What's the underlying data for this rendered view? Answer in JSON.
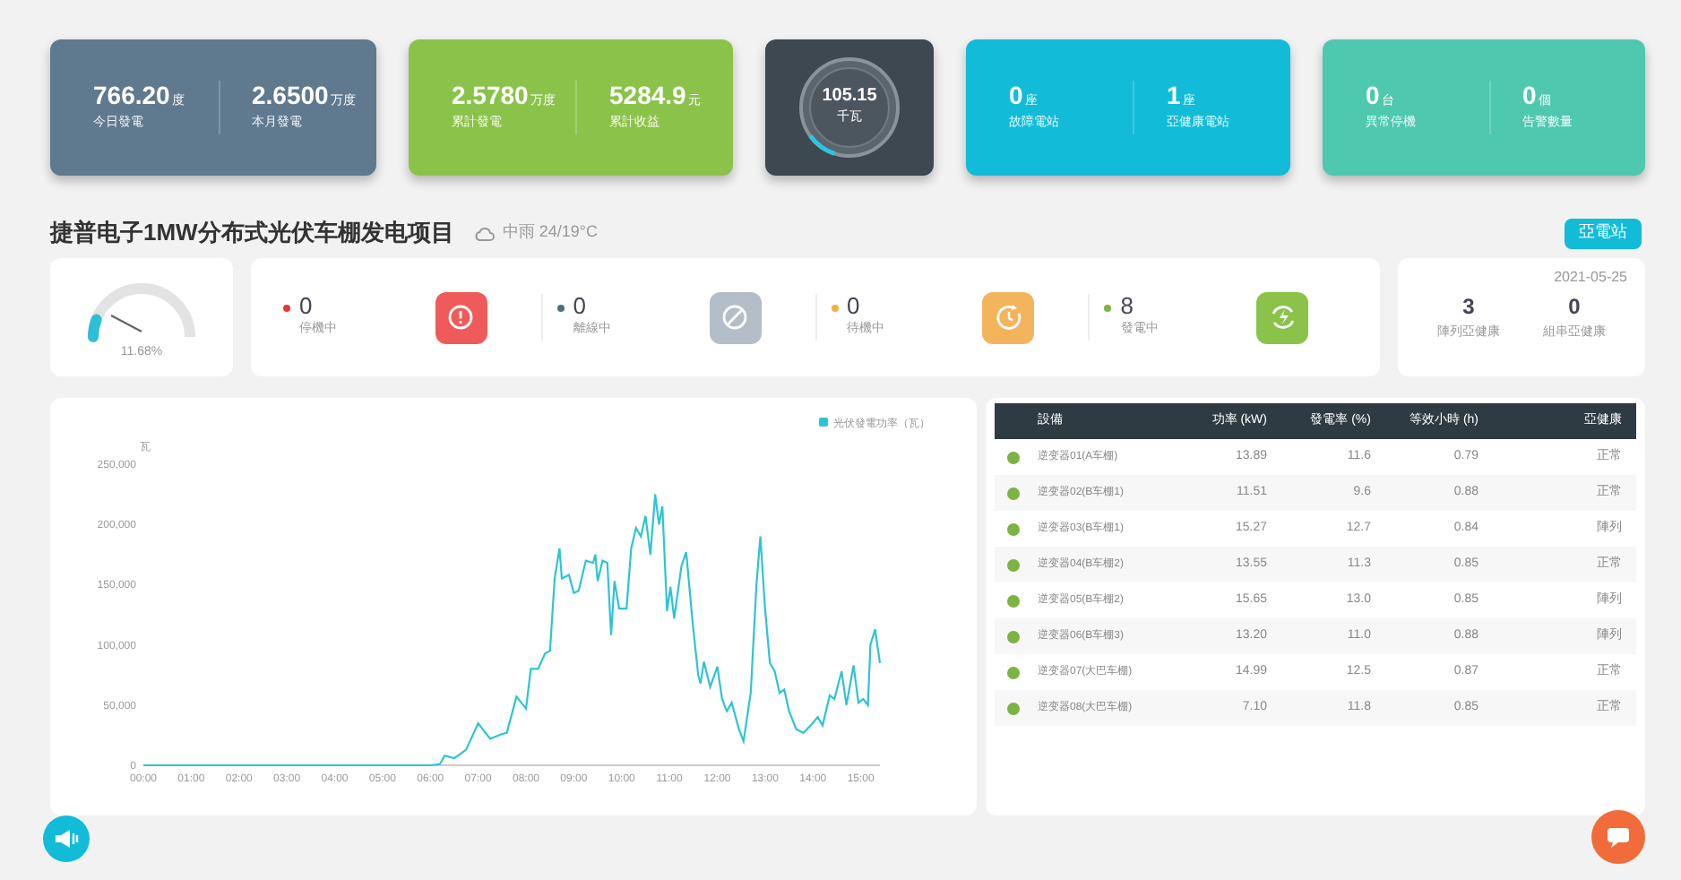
{
  "stat_cards": [
    {
      "kind": "pair",
      "color": "#5f7a8f",
      "items": [
        {
          "value": "766.20",
          "unit": "度",
          "label": "今日發電"
        },
        {
          "value": "2.6500",
          "unit": "万度",
          "label": "本月發電"
        }
      ]
    },
    {
      "kind": "pair",
      "color": "#8bc34a",
      "items": [
        {
          "value": "2.5780",
          "unit": "万度",
          "label": "累計發電"
        },
        {
          "value": "5284.9",
          "unit": "元",
          "label": "累計收益"
        }
      ]
    },
    {
      "kind": "gauge",
      "color": "#3d4850",
      "value": "105.15",
      "label": "千瓦",
      "level": 0.1
    },
    {
      "kind": "pair",
      "color": "#12bcd8",
      "items": [
        {
          "value": "0",
          "unit": "座",
          "label": "故障電站"
        },
        {
          "value": "1",
          "unit": "座",
          "label": "亞健康電站"
        }
      ]
    },
    {
      "kind": "pair",
      "color": "#4fc8b0",
      "items": [
        {
          "value": "0",
          "unit": "台",
          "label": "異常停機"
        },
        {
          "value": "0",
          "unit": "個",
          "label": "告警數量"
        }
      ]
    }
  ],
  "project": {
    "title": "捷普电子1MW分布式光伏车棚发电项目",
    "weather": "中雨 24/19°C",
    "button": "亞電站"
  },
  "efficiency_gauge": {
    "reading": "11.68%",
    "level": 0.1168
  },
  "statuses": [
    {
      "count": "0",
      "label": "停機中",
      "color": "#e53935",
      "kind": "alert"
    },
    {
      "count": "0",
      "label": "離線中",
      "color": "#546e7a",
      "kind": "offline"
    },
    {
      "count": "0",
      "label": "待機中",
      "color": "#f3b23c",
      "kind": "standby"
    },
    {
      "count": "8",
      "label": "發電中",
      "color": "#7cb342",
      "kind": "generating"
    }
  ],
  "health": {
    "date": "2021-05-25",
    "items": [
      {
        "value": "3",
        "label": "陣列亞健康"
      },
      {
        "value": "0",
        "label": "組串亞健康"
      }
    ]
  },
  "chart_data": {
    "type": "line",
    "ylabel": "瓦",
    "x": [
      0,
      6,
      6.2,
      6.3,
      6.5,
      6.75,
      7,
      7.25,
      7.5,
      7.6,
      7.8,
      8,
      8.1,
      8.25,
      8.4,
      8.5,
      8.6,
      8.7,
      8.75,
      8.9,
      9,
      9.1,
      9.25,
      9.4,
      9.45,
      9.5,
      9.6,
      9.7,
      9.78,
      9.85,
      9.95,
      10.1,
      10.2,
      10.3,
      10.4,
      10.5,
      10.6,
      10.7,
      10.78,
      10.85,
      10.95,
      11.02,
      11.1,
      11.25,
      11.35,
      11.48,
      11.6,
      11.65,
      11.72,
      11.85,
      12,
      12.1,
      12.2,
      12.3,
      12.45,
      12.55,
      12.7,
      12.82,
      12.9,
      13,
      13.1,
      13.2,
      13.3,
      13.4,
      13.5,
      13.65,
      13.8,
      13.95,
      14.1,
      14.2,
      14.35,
      14.45,
      14.6,
      14.7,
      14.85,
      14.95,
      15.05,
      15.15,
      15.2,
      15.3,
      15.4
    ],
    "series": [
      {
        "name": "光伏發電功率（瓦）",
        "color": "#2ec4d4",
        "values": [
          0,
          0,
          1000,
          8000,
          6000,
          13000,
          35000,
          22000,
          26000,
          27000,
          57000,
          47000,
          80000,
          80000,
          93000,
          95000,
          155000,
          180000,
          155000,
          158000,
          143000,
          145000,
          170000,
          168000,
          175000,
          153000,
          170000,
          168000,
          108000,
          153000,
          130000,
          130000,
          180000,
          197000,
          190000,
          207000,
          175000,
          225000,
          200000,
          215000,
          128000,
          148000,
          122000,
          165000,
          177000,
          120000,
          75000,
          68000,
          86000,
          65000,
          82000,
          55000,
          45000,
          52000,
          30000,
          20000,
          60000,
          150000,
          190000,
          130000,
          85000,
          78000,
          60000,
          63000,
          45000,
          30000,
          27000,
          33000,
          40000,
          33000,
          58000,
          55000,
          78000,
          50000,
          83000,
          52000,
          55000,
          50000,
          100000,
          113000,
          85000
        ]
      }
    ],
    "xlim": [
      0,
      15.4
    ],
    "ylim": [
      0,
      250000
    ],
    "xticks": [
      {
        "value": 0,
        "label": "00:00"
      },
      {
        "value": 1,
        "label": "01:00"
      },
      {
        "value": 2,
        "label": "02:00"
      },
      {
        "value": 3,
        "label": "03:00"
      },
      {
        "value": 4,
        "label": "04:00"
      },
      {
        "value": 5,
        "label": "05:00"
      },
      {
        "value": 6,
        "label": "06:00"
      },
      {
        "value": 7,
        "label": "07:00"
      },
      {
        "value": 8,
        "label": "08:00"
      },
      {
        "value": 9,
        "label": "09:00"
      },
      {
        "value": 10,
        "label": "10:00"
      },
      {
        "value": 11,
        "label": "11:00"
      },
      {
        "value": 12,
        "label": "12:00"
      },
      {
        "value": 13,
        "label": "13:00"
      },
      {
        "value": 14,
        "label": "14:00"
      },
      {
        "value": 15,
        "label": "15:00"
      }
    ],
    "yticks": [
      {
        "value": 0,
        "label": "0"
      },
      {
        "value": 50000,
        "label": "50,000"
      },
      {
        "value": 100000,
        "label": "100,000"
      },
      {
        "value": 150000,
        "label": "150,000"
      },
      {
        "value": 200000,
        "label": "200,000"
      },
      {
        "value": 250000,
        "label": "250,000"
      }
    ]
  },
  "table": {
    "columns": [
      "設備",
      "功率 (kW)",
      "發電率 (%)",
      "等效小時 (h)",
      "亞健康"
    ],
    "rows": [
      {
        "color": "#7cb342",
        "cells": [
          "逆变器01(A车棚)",
          "13.89",
          "11.6",
          "0.79",
          "正常"
        ]
      },
      {
        "color": "#7cb342",
        "cells": [
          "逆变器02(B车棚1)",
          "11.51",
          "9.6",
          "0.88",
          "正常"
        ]
      },
      {
        "color": "#7cb342",
        "cells": [
          "逆变器03(B车棚1)",
          "15.27",
          "12.7",
          "0.84",
          "陣列"
        ]
      },
      {
        "color": "#7cb342",
        "cells": [
          "逆变器04(B车棚2)",
          "13.55",
          "11.3",
          "0.85",
          "正常"
        ]
      },
      {
        "color": "#7cb342",
        "cells": [
          "逆变器05(B车棚2)",
          "15.65",
          "13.0",
          "0.85",
          "陣列"
        ]
      },
      {
        "color": "#7cb342",
        "cells": [
          "逆变器06(B车棚3)",
          "13.20",
          "11.0",
          "0.88",
          "陣列"
        ]
      },
      {
        "color": "#7cb342",
        "cells": [
          "逆变器07(大巴车棚)",
          "14.99",
          "12.5",
          "0.87",
          "正常"
        ]
      },
      {
        "color": "#7cb342",
        "cells": [
          "逆变器08(大巴车棚)",
          "7.10",
          "11.8",
          "0.85",
          "正常"
        ]
      }
    ]
  }
}
